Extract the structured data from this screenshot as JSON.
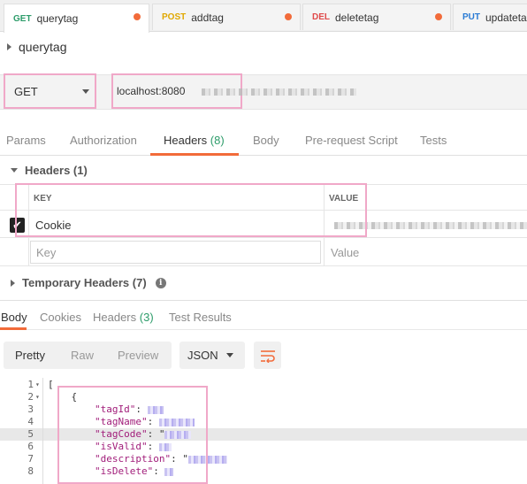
{
  "tabs": [
    {
      "method": "GET",
      "name": "querytag",
      "method_color": "#2d9c6a",
      "active": true
    },
    {
      "method": "POST",
      "name": "addtag",
      "method_color": "#e0a800",
      "active": false
    },
    {
      "method": "DEL",
      "name": "deletetag",
      "method_color": "#e04a4a",
      "active": false
    },
    {
      "method": "PUT",
      "name": "updatetag",
      "method_color": "#2a7bd4",
      "active": false
    }
  ],
  "request": {
    "title": "querytag",
    "method": "GET",
    "url": "localhost:8080"
  },
  "request_tabs": [
    {
      "label": "Params",
      "count": ""
    },
    {
      "label": "Authorization",
      "count": ""
    },
    {
      "label": "Headers",
      "count": "(8)"
    },
    {
      "label": "Body",
      "count": ""
    },
    {
      "label": "Pre-request Script",
      "count": ""
    },
    {
      "label": "Tests",
      "count": ""
    }
  ],
  "headers_section": {
    "title": "Headers (1)",
    "key_column": "KEY",
    "value_column": "VALUE",
    "rows": [
      {
        "key": "Cookie",
        "checked": true
      }
    ],
    "key_placeholder": "Key",
    "value_placeholder": "Value"
  },
  "temporary_headers": {
    "title": "Temporary Headers (7)"
  },
  "response_tabs": [
    {
      "label": "Body",
      "count": ""
    },
    {
      "label": "Cookies",
      "count": ""
    },
    {
      "label": "Headers",
      "count": "(3)"
    },
    {
      "label": "Test Results",
      "count": ""
    }
  ],
  "view_modes": [
    "Pretty",
    "Raw",
    "Preview"
  ],
  "format": "JSON",
  "code_lines": [
    {
      "n": "1",
      "fold": "▾",
      "text": "["
    },
    {
      "n": "2",
      "fold": "▾",
      "text": "    {"
    },
    {
      "n": "3",
      "fold": "",
      "key": "\"tagId\"",
      "text": ": "
    },
    {
      "n": "4",
      "fold": "",
      "key": "\"tagName\"",
      "text": ": "
    },
    {
      "n": "5",
      "fold": "",
      "key": "\"tagCode\"",
      "text": ": \""
    },
    {
      "n": "6",
      "fold": "",
      "key": "\"isValid\"",
      "text": ": "
    },
    {
      "n": "7",
      "fold": "",
      "key": "\"description\"",
      "text": ": \""
    },
    {
      "n": "8",
      "fold": "",
      "key": "\"isDelete\"",
      "text": ": "
    }
  ],
  "colors": {
    "accent": "#f26b3a",
    "count_green": "#2d9c6a",
    "highlight_pink": "#f0a8c8"
  }
}
